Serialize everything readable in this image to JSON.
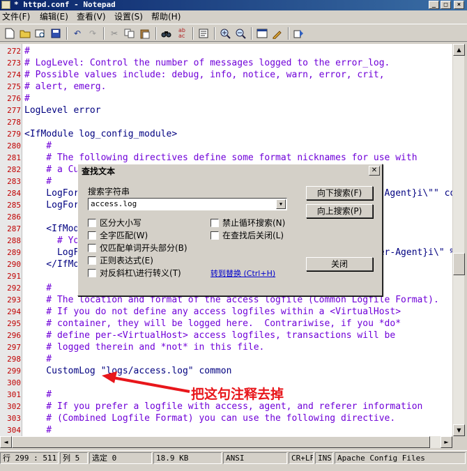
{
  "window": {
    "title": "* httpd.conf - Notepad",
    "controls": [
      "_",
      "□",
      "×"
    ]
  },
  "menu": [
    {
      "label": "文件(F)"
    },
    {
      "label": "编辑(E)"
    },
    {
      "label": "查看(V)"
    },
    {
      "label": "设置(S)"
    },
    {
      "label": "帮助(H)"
    }
  ],
  "toolbar": {
    "icons": [
      "new-file-icon",
      "open-folder-icon",
      "find-in-files-icon",
      "save-icon",
      "undo-icon",
      "redo-icon",
      "cut-icon",
      "copy-icon",
      "paste-icon",
      "find-icon",
      "replace-icon",
      "page-setup-icon",
      "zoom-in-icon",
      "zoom-out-icon",
      "view-icon",
      "edit-icon",
      "run-icon"
    ]
  },
  "editor": {
    "lines": [
      {
        "n": "272",
        "text": "#",
        "kind": "comment"
      },
      {
        "n": "273",
        "text": "# LogLevel: Control the number of messages logged to the error_log.",
        "kind": "comment"
      },
      {
        "n": "274",
        "text": "# Possible values include: debug, info, notice, warn, error, crit,",
        "kind": "comment"
      },
      {
        "n": "275",
        "text": "# alert, emerg.",
        "kind": "comment"
      },
      {
        "n": "276",
        "text": "#",
        "kind": "comment"
      },
      {
        "n": "277",
        "text": "LogLevel error",
        "kind": "dir"
      },
      {
        "n": "278",
        "text": "",
        "kind": "plain"
      },
      {
        "n": "279",
        "text": "<IfModule log_config_module>",
        "kind": "dir"
      },
      {
        "n": "280",
        "text": "    #",
        "kind": "comment"
      },
      {
        "n": "281",
        "text": "    # The following directives define some format nicknames for use with",
        "kind": "comment"
      },
      {
        "n": "282",
        "text": "    # a CustomLog directive (see below).",
        "kind": "comment"
      },
      {
        "n": "283",
        "text": "    #",
        "kind": "comment"
      },
      {
        "n": "284",
        "text": "    LogFormat \"%h %l %u %t \\\"%r\\\" %>s %b \\\"%{Referer}i\\\" \\\"%{User-Agent}i\\\"\" combined",
        "kind": "dir"
      },
      {
        "n": "285",
        "text": "    LogFormat \"%h %l %u %t \\\"%r\\\" %>s %b\" common",
        "kind": "dir"
      },
      {
        "n": "286",
        "text": "",
        "kind": "plain"
      },
      {
        "n": "287",
        "text": "    <IfModule logio_module>",
        "kind": "dir"
      },
      {
        "n": "288",
        "text": "      # You need to enable mod_logio.c to use %I and %O",
        "kind": "comment"
      },
      {
        "n": "289",
        "text": "      LogFormat \"%h %l %u %t \\\"%r\\\" %>s %b \\\"%{Referer}i\\\" \\\"%{User-Agent}i\\\" %I %O\" combinedio",
        "kind": "dir"
      },
      {
        "n": "290",
        "text": "    </IfModule>",
        "kind": "dir"
      },
      {
        "n": "291",
        "text": "",
        "kind": "plain"
      },
      {
        "n": "292",
        "text": "    #",
        "kind": "comment"
      },
      {
        "n": "293",
        "text": "    # The location and format of the access logfile (Common Logfile Format).",
        "kind": "comment"
      },
      {
        "n": "294",
        "text": "    # If you do not define any access logfiles within a <VirtualHost>",
        "kind": "comment"
      },
      {
        "n": "295",
        "text": "    # container, they will be logged here.  Contrariwise, if you *do*",
        "kind": "comment"
      },
      {
        "n": "296",
        "text": "    # define per-<VirtualHost> access logfiles, transactions will be",
        "kind": "comment"
      },
      {
        "n": "297",
        "text": "    # logged therein and *not* in this file.",
        "kind": "comment"
      },
      {
        "n": "298",
        "text": "    #",
        "kind": "comment"
      },
      {
        "n": "299",
        "text": "    CustomLog \"logs/access.log\" common",
        "kind": "dir"
      },
      {
        "n": "300",
        "text": "",
        "kind": "plain"
      },
      {
        "n": "301",
        "text": "    #",
        "kind": "comment"
      },
      {
        "n": "302",
        "text": "    # If you prefer a logfile with access, agent, and referer information",
        "kind": "comment"
      },
      {
        "n": "303",
        "text": "    # (Combined Logfile Format) you can use the following directive.",
        "kind": "comment"
      },
      {
        "n": "304",
        "text": "    #",
        "kind": "comment"
      }
    ]
  },
  "find_dialog": {
    "title": "查找文本",
    "search_label": "搜索字符串",
    "search_value": "access.log",
    "find_next": "向下搜索(F)",
    "find_prev": "向上搜索(P)",
    "close": "关闭",
    "options_left": [
      "区分大小写",
      "全字匹配(W)",
      "仅匹配单词开头部分(B)",
      "正则表达式(E)",
      "对反斜杠\\进行转义(T)"
    ],
    "options_right": [
      "禁止循环搜索(N)",
      "在查找后关闭(L)"
    ],
    "goto_replace": "转到替换 (Ctrl+H)"
  },
  "statusbar": {
    "position": "行 299 : 511",
    "column": "列 5",
    "selection": "选定 0",
    "size": "18.9 KB",
    "encoding": "ANSI",
    "eol": "CR+LF",
    "mode": "INS",
    "scheme": "Apache Config Files"
  },
  "annotation": {
    "text": "把这句注释去掉",
    "color": "#e8161b"
  }
}
